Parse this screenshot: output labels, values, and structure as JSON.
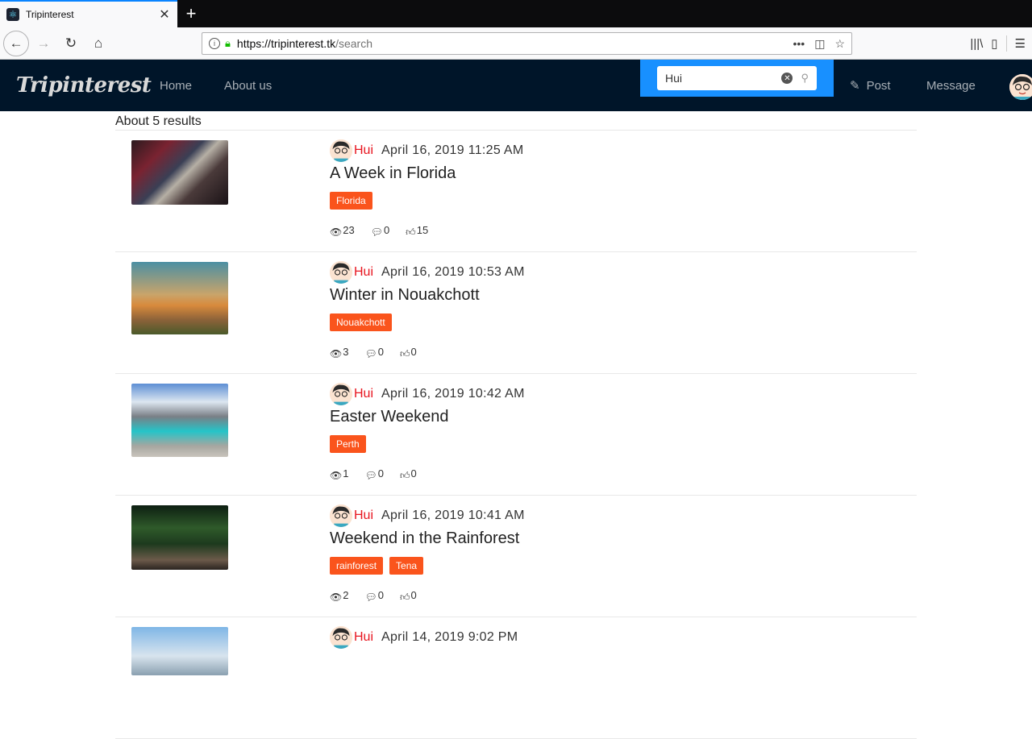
{
  "browser": {
    "tab_title": "Tripinterest",
    "url_host": "https://tripinterest.tk",
    "url_path": "/search"
  },
  "app": {
    "logo": "Tripinterest",
    "menu": [
      "Home",
      "About us"
    ],
    "search_value": "Hui",
    "post_label": "Post",
    "message_label": "Message"
  },
  "results": {
    "count_text": "About 5 results",
    "items": [
      {
        "author": "Hui",
        "date": "April 16, 2019 11:25 AM",
        "title": "A Week in Florida",
        "tags": [
          "Florida"
        ],
        "views": "23",
        "comments": "0",
        "likes": "15"
      },
      {
        "author": "Hui",
        "date": "April 16, 2019 10:53 AM",
        "title": "Winter in Nouakchott",
        "tags": [
          "Nouakchott"
        ],
        "views": "3",
        "comments": "0",
        "likes": "0"
      },
      {
        "author": "Hui",
        "date": "April 16, 2019 10:42 AM",
        "title": "Easter Weekend",
        "tags": [
          "Perth"
        ],
        "views": "1",
        "comments": "0",
        "likes": "0"
      },
      {
        "author": "Hui",
        "date": "April 16, 2019 10:41 AM",
        "title": "Weekend in the Rainforest",
        "tags": [
          "rainforest",
          "Tena"
        ],
        "views": "2",
        "comments": "0",
        "likes": "0"
      },
      {
        "author": "Hui",
        "date": "April 14, 2019 9:02 PM",
        "title": "",
        "tags": [],
        "views": "",
        "comments": "",
        "likes": ""
      }
    ]
  },
  "colors": {
    "header_bg": "#001529",
    "search_bg": "#1890ff",
    "tag_bg": "#fa541c",
    "author": "#e8151f"
  }
}
